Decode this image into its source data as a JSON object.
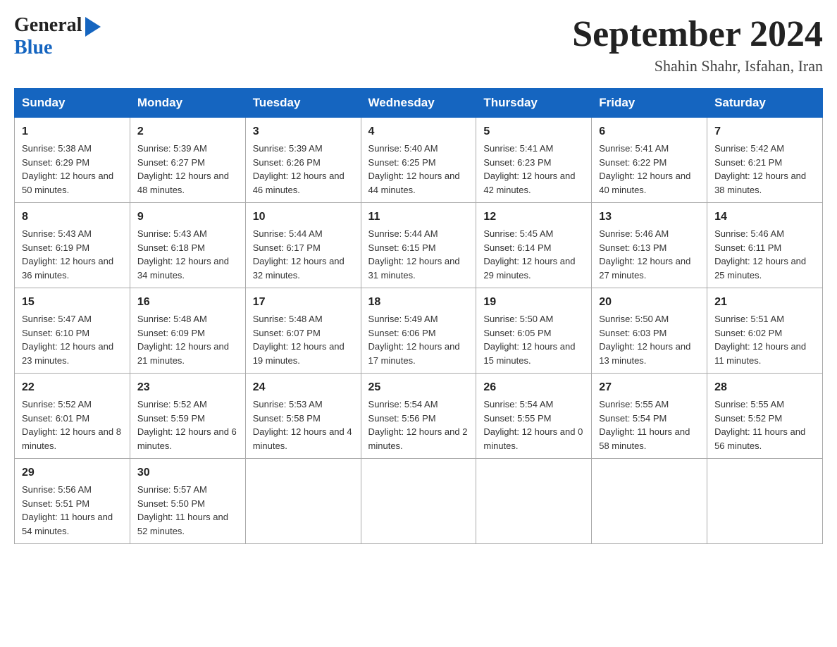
{
  "logo": {
    "general": "General",
    "blue": "Blue"
  },
  "title": "September 2024",
  "subtitle": "Shahin Shahr, Isfahan, Iran",
  "weekdays": [
    "Sunday",
    "Monday",
    "Tuesday",
    "Wednesday",
    "Thursday",
    "Friday",
    "Saturday"
  ],
  "weeks": [
    [
      {
        "day": "1",
        "sunrise": "Sunrise: 5:38 AM",
        "sunset": "Sunset: 6:29 PM",
        "daylight": "Daylight: 12 hours and 50 minutes."
      },
      {
        "day": "2",
        "sunrise": "Sunrise: 5:39 AM",
        "sunset": "Sunset: 6:27 PM",
        "daylight": "Daylight: 12 hours and 48 minutes."
      },
      {
        "day": "3",
        "sunrise": "Sunrise: 5:39 AM",
        "sunset": "Sunset: 6:26 PM",
        "daylight": "Daylight: 12 hours and 46 minutes."
      },
      {
        "day": "4",
        "sunrise": "Sunrise: 5:40 AM",
        "sunset": "Sunset: 6:25 PM",
        "daylight": "Daylight: 12 hours and 44 minutes."
      },
      {
        "day": "5",
        "sunrise": "Sunrise: 5:41 AM",
        "sunset": "Sunset: 6:23 PM",
        "daylight": "Daylight: 12 hours and 42 minutes."
      },
      {
        "day": "6",
        "sunrise": "Sunrise: 5:41 AM",
        "sunset": "Sunset: 6:22 PM",
        "daylight": "Daylight: 12 hours and 40 minutes."
      },
      {
        "day": "7",
        "sunrise": "Sunrise: 5:42 AM",
        "sunset": "Sunset: 6:21 PM",
        "daylight": "Daylight: 12 hours and 38 minutes."
      }
    ],
    [
      {
        "day": "8",
        "sunrise": "Sunrise: 5:43 AM",
        "sunset": "Sunset: 6:19 PM",
        "daylight": "Daylight: 12 hours and 36 minutes."
      },
      {
        "day": "9",
        "sunrise": "Sunrise: 5:43 AM",
        "sunset": "Sunset: 6:18 PM",
        "daylight": "Daylight: 12 hours and 34 minutes."
      },
      {
        "day": "10",
        "sunrise": "Sunrise: 5:44 AM",
        "sunset": "Sunset: 6:17 PM",
        "daylight": "Daylight: 12 hours and 32 minutes."
      },
      {
        "day": "11",
        "sunrise": "Sunrise: 5:44 AM",
        "sunset": "Sunset: 6:15 PM",
        "daylight": "Daylight: 12 hours and 31 minutes."
      },
      {
        "day": "12",
        "sunrise": "Sunrise: 5:45 AM",
        "sunset": "Sunset: 6:14 PM",
        "daylight": "Daylight: 12 hours and 29 minutes."
      },
      {
        "day": "13",
        "sunrise": "Sunrise: 5:46 AM",
        "sunset": "Sunset: 6:13 PM",
        "daylight": "Daylight: 12 hours and 27 minutes."
      },
      {
        "day": "14",
        "sunrise": "Sunrise: 5:46 AM",
        "sunset": "Sunset: 6:11 PM",
        "daylight": "Daylight: 12 hours and 25 minutes."
      }
    ],
    [
      {
        "day": "15",
        "sunrise": "Sunrise: 5:47 AM",
        "sunset": "Sunset: 6:10 PM",
        "daylight": "Daylight: 12 hours and 23 minutes."
      },
      {
        "day": "16",
        "sunrise": "Sunrise: 5:48 AM",
        "sunset": "Sunset: 6:09 PM",
        "daylight": "Daylight: 12 hours and 21 minutes."
      },
      {
        "day": "17",
        "sunrise": "Sunrise: 5:48 AM",
        "sunset": "Sunset: 6:07 PM",
        "daylight": "Daylight: 12 hours and 19 minutes."
      },
      {
        "day": "18",
        "sunrise": "Sunrise: 5:49 AM",
        "sunset": "Sunset: 6:06 PM",
        "daylight": "Daylight: 12 hours and 17 minutes."
      },
      {
        "day": "19",
        "sunrise": "Sunrise: 5:50 AM",
        "sunset": "Sunset: 6:05 PM",
        "daylight": "Daylight: 12 hours and 15 minutes."
      },
      {
        "day": "20",
        "sunrise": "Sunrise: 5:50 AM",
        "sunset": "Sunset: 6:03 PM",
        "daylight": "Daylight: 12 hours and 13 minutes."
      },
      {
        "day": "21",
        "sunrise": "Sunrise: 5:51 AM",
        "sunset": "Sunset: 6:02 PM",
        "daylight": "Daylight: 12 hours and 11 minutes."
      }
    ],
    [
      {
        "day": "22",
        "sunrise": "Sunrise: 5:52 AM",
        "sunset": "Sunset: 6:01 PM",
        "daylight": "Daylight: 12 hours and 8 minutes."
      },
      {
        "day": "23",
        "sunrise": "Sunrise: 5:52 AM",
        "sunset": "Sunset: 5:59 PM",
        "daylight": "Daylight: 12 hours and 6 minutes."
      },
      {
        "day": "24",
        "sunrise": "Sunrise: 5:53 AM",
        "sunset": "Sunset: 5:58 PM",
        "daylight": "Daylight: 12 hours and 4 minutes."
      },
      {
        "day": "25",
        "sunrise": "Sunrise: 5:54 AM",
        "sunset": "Sunset: 5:56 PM",
        "daylight": "Daylight: 12 hours and 2 minutes."
      },
      {
        "day": "26",
        "sunrise": "Sunrise: 5:54 AM",
        "sunset": "Sunset: 5:55 PM",
        "daylight": "Daylight: 12 hours and 0 minutes."
      },
      {
        "day": "27",
        "sunrise": "Sunrise: 5:55 AM",
        "sunset": "Sunset: 5:54 PM",
        "daylight": "Daylight: 11 hours and 58 minutes."
      },
      {
        "day": "28",
        "sunrise": "Sunrise: 5:55 AM",
        "sunset": "Sunset: 5:52 PM",
        "daylight": "Daylight: 11 hours and 56 minutes."
      }
    ],
    [
      {
        "day": "29",
        "sunrise": "Sunrise: 5:56 AM",
        "sunset": "Sunset: 5:51 PM",
        "daylight": "Daylight: 11 hours and 54 minutes."
      },
      {
        "day": "30",
        "sunrise": "Sunrise: 5:57 AM",
        "sunset": "Sunset: 5:50 PM",
        "daylight": "Daylight: 11 hours and 52 minutes."
      },
      null,
      null,
      null,
      null,
      null
    ]
  ]
}
